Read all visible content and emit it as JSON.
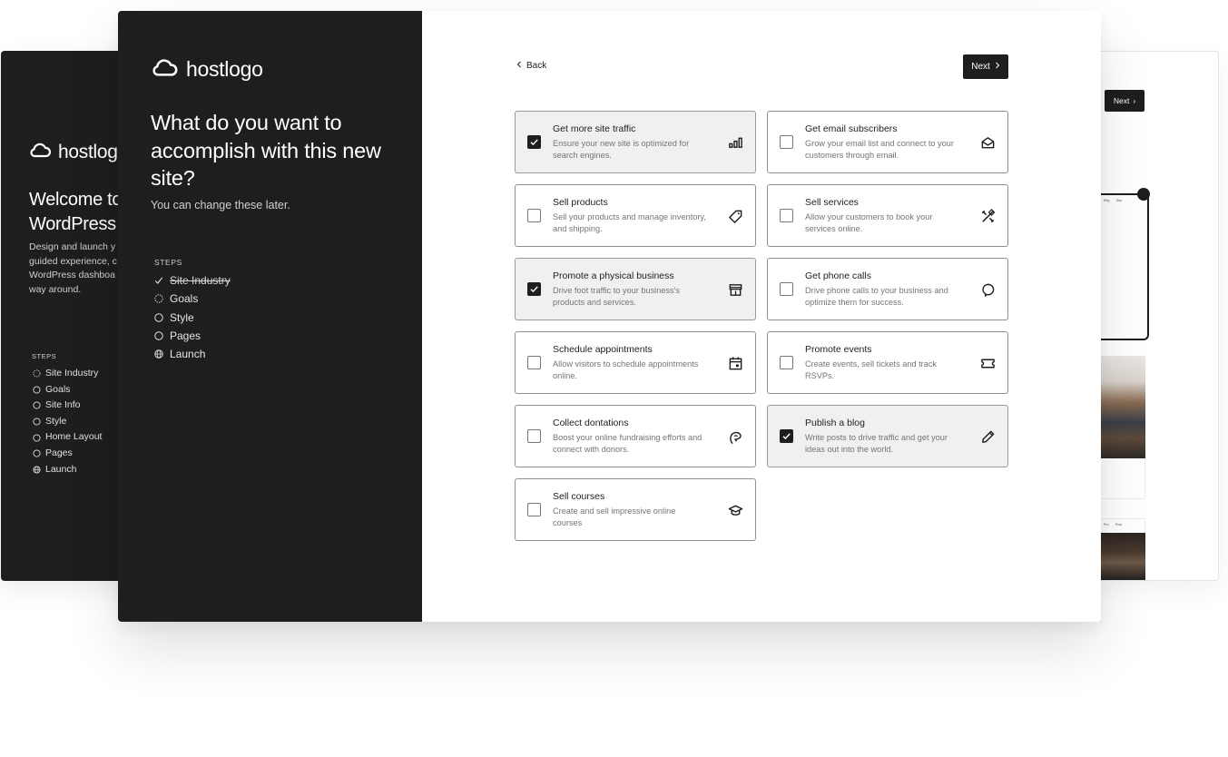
{
  "brand": {
    "logo_text": "hostlogo"
  },
  "back_left_window": {
    "logo_text": "hostlog",
    "title_lines": [
      "Welcome to",
      "WordPress"
    ],
    "desc_lines": [
      "Design and launch y",
      "guided experience, c",
      "WordPress dashboa",
      "way around."
    ],
    "steps_heading": "STEPS",
    "steps": [
      {
        "label": "Site Industry",
        "icon": "dotted-circle-icon"
      },
      {
        "label": "Goals",
        "icon": "circle-icon"
      },
      {
        "label": "Site Info",
        "icon": "circle-icon"
      },
      {
        "label": "Style",
        "icon": "circle-icon"
      },
      {
        "label": "Home Layout",
        "icon": "circle-icon"
      },
      {
        "label": "Pages",
        "icon": "circle-icon"
      },
      {
        "label": "Launch",
        "icon": "globe-icon"
      }
    ]
  },
  "back_right_window": {
    "next_label": "Next",
    "mini_nav_1": [
      "Reg",
      "Stor"
    ],
    "mini_nav_2": [
      "Pro",
      "Prac"
    ]
  },
  "sidebar": {
    "title": "What do you want to accomplish with this new site?",
    "subtitle": "You can change these later.",
    "steps_heading": "STEPS",
    "steps": [
      {
        "label": "Site Industry",
        "state": "done",
        "icon": "check-icon"
      },
      {
        "label": "Goals",
        "state": "current",
        "icon": "dotted-circle-icon"
      },
      {
        "label": "Style",
        "state": "todo",
        "icon": "circle-icon"
      },
      {
        "label": "Pages",
        "state": "todo",
        "icon": "circle-icon"
      },
      {
        "label": "Launch",
        "state": "todo",
        "icon": "globe-icon"
      }
    ]
  },
  "nav": {
    "back_label": "Back",
    "next_label": "Next"
  },
  "goals": [
    {
      "title": "Get more site traffic",
      "desc": "Ensure your new site is optimized for search engines.",
      "checked": true,
      "icon": "chart-bars-icon"
    },
    {
      "title": "Get email subscribers",
      "desc": "Grow your email list and connect to your customers through email.",
      "checked": false,
      "icon": "envelope-open-icon"
    },
    {
      "title": "Sell products",
      "desc": "Sell your products and manage inventory, and shipping.",
      "checked": false,
      "icon": "price-tag-icon"
    },
    {
      "title": "Sell services",
      "desc": "Allow your customers to book your services online.",
      "checked": false,
      "icon": "tools-icon"
    },
    {
      "title": "Promote a physical business",
      "desc": "Drive foot traffic to your business's products and services.",
      "checked": true,
      "icon": "storefront-icon"
    },
    {
      "title": "Get phone calls",
      "desc": "Drive phone calls to your business and optimize them for success.",
      "checked": false,
      "icon": "speech-bubble-icon"
    },
    {
      "title": "Schedule appointments",
      "desc": "Allow visitors to schedule appointments online.",
      "checked": false,
      "icon": "calendar-icon"
    },
    {
      "title": "Promote events",
      "desc": "Create events, sell tickets and track RSVPs.",
      "checked": false,
      "icon": "ticket-icon"
    },
    {
      "title": "Collect dontations",
      "desc": "Boost your online fundraising efforts and connect with donors.",
      "checked": false,
      "icon": "donation-hand-icon"
    },
    {
      "title": "Publish a blog",
      "desc": "Write posts to drive traffic and get your ideas out into the world.",
      "checked": true,
      "icon": "pencil-icon"
    },
    {
      "title": "Sell courses",
      "desc": "Create and sell impressive online courses",
      "checked": false,
      "icon": "graduation-cap-icon"
    }
  ]
}
